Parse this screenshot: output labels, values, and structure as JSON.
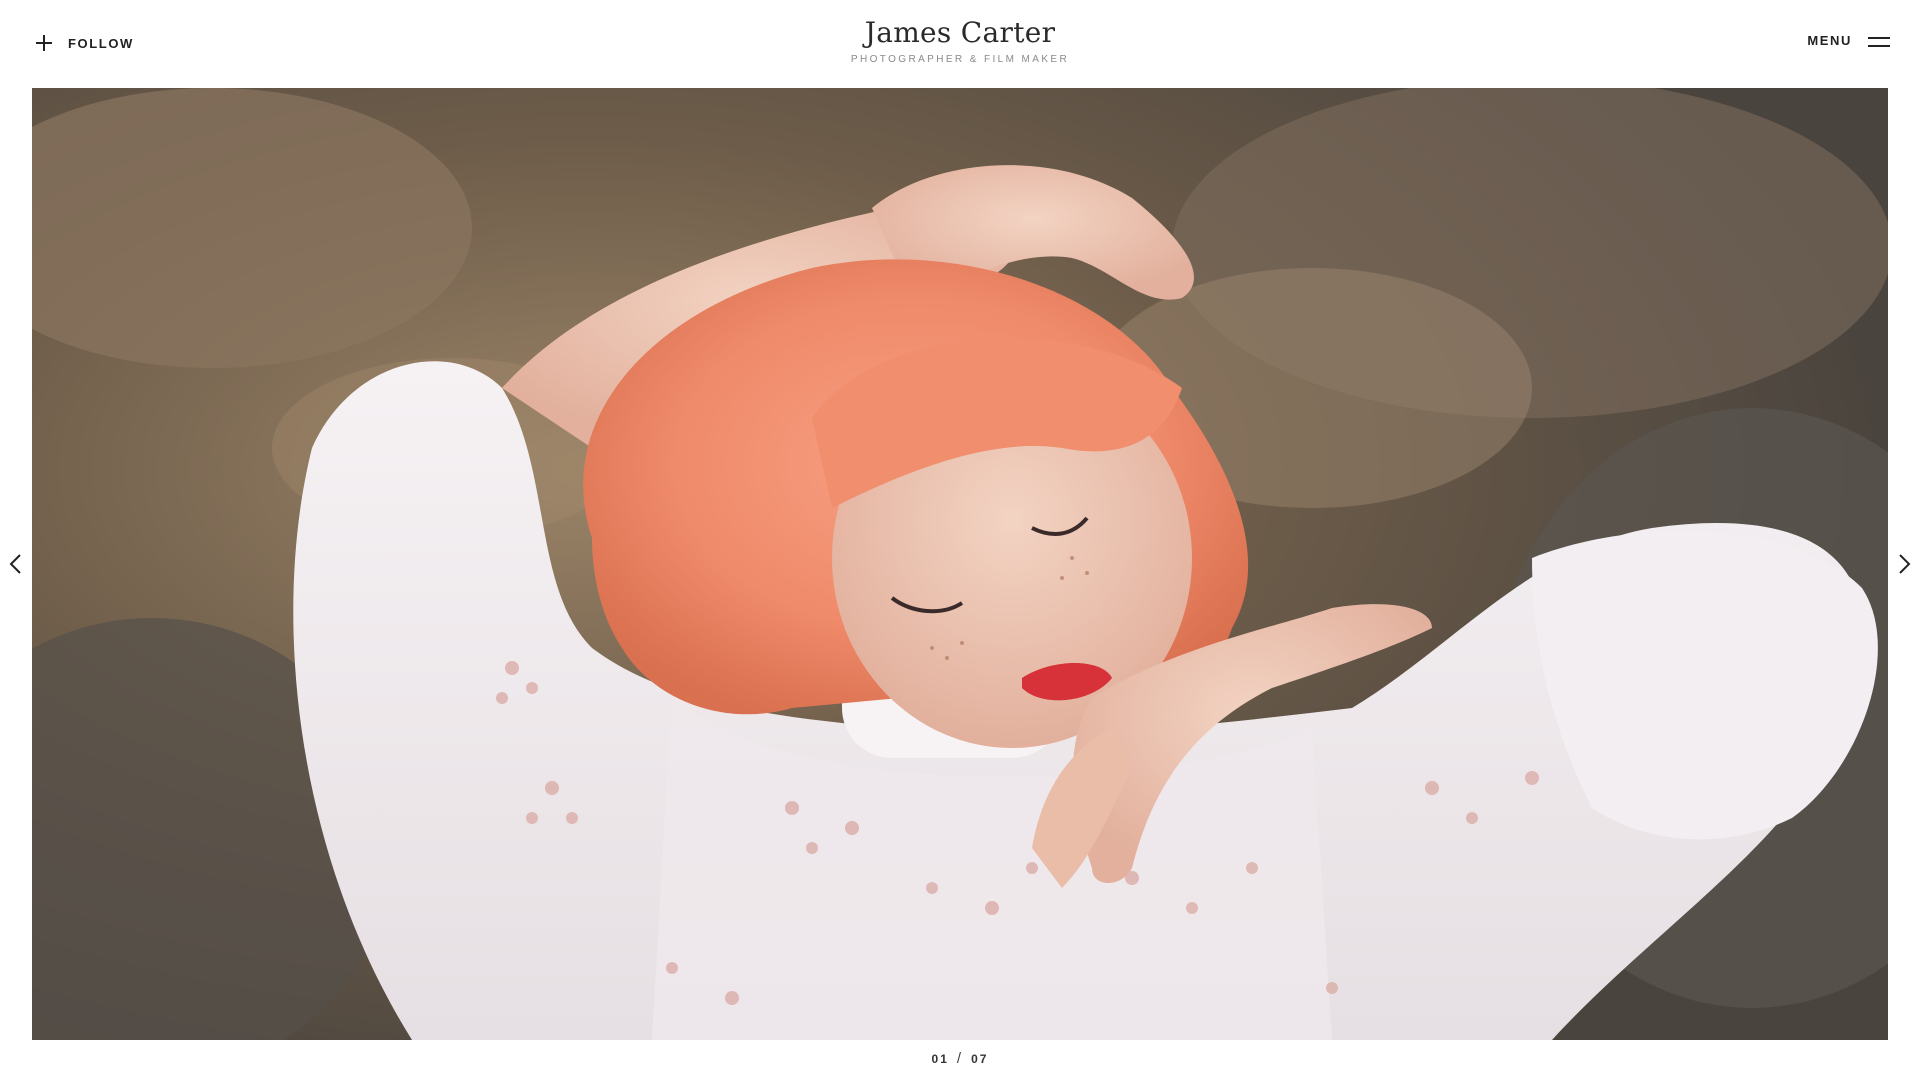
{
  "header": {
    "follow_label": "FOLLOW",
    "site_name": "James Carter",
    "tagline": "PHOTOGRAPHER & FILM MAKER",
    "menu_label": "MENU"
  },
  "slider": {
    "current": "01",
    "separator": "/",
    "total": "07"
  },
  "icons": {
    "follow": "plus-icon",
    "menu": "hamburger-icon",
    "prev": "chevron-left-icon",
    "next": "chevron-right-icon"
  },
  "colors": {
    "text": "#222222",
    "tagline": "#8a8a8a",
    "background": "#ffffff"
  }
}
